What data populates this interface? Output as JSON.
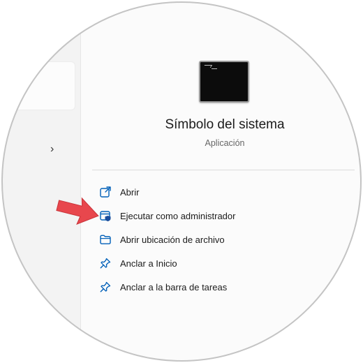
{
  "app": {
    "title": "Símbolo del sistema",
    "subtitle": "Aplicación",
    "icon": "command-prompt-icon"
  },
  "left_pane": {
    "chevron_icon": "chevron-right-icon",
    "chevron_glyph": "›"
  },
  "actions": [
    {
      "label": "Abrir",
      "icon": "open-external-icon"
    },
    {
      "label": "Ejecutar como administrador",
      "icon": "run-as-admin-icon"
    },
    {
      "label": "Abrir ubicación de archivo",
      "icon": "folder-icon"
    },
    {
      "label": "Anclar a Inicio",
      "icon": "pin-icon"
    },
    {
      "label": "Anclar a la barra de tareas",
      "icon": "pin-icon"
    }
  ],
  "colors": {
    "accent": "#005fb8",
    "arrow": "#e8474d",
    "admin_badge": "#1a4d9c"
  }
}
